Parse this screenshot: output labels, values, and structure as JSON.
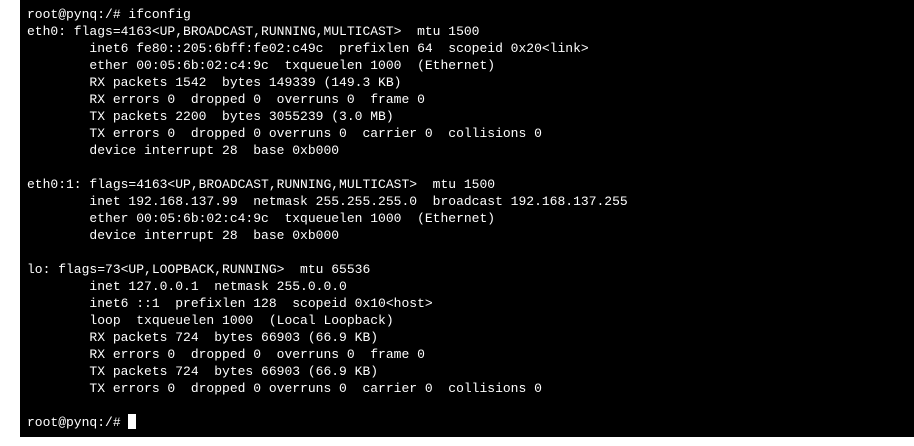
{
  "terminal": {
    "lines": [
      "root@pynq:/# ifconfig",
      "eth0: flags=4163<UP,BROADCAST,RUNNING,MULTICAST>  mtu 1500",
      "        inet6 fe80::205:6bff:fe02:c49c  prefixlen 64  scopeid 0x20<link>",
      "        ether 00:05:6b:02:c4:9c  txqueuelen 1000  (Ethernet)",
      "        RX packets 1542  bytes 149339 (149.3 KB)",
      "        RX errors 0  dropped 0  overruns 0  frame 0",
      "        TX packets 2200  bytes 3055239 (3.0 MB)",
      "        TX errors 0  dropped 0 overruns 0  carrier 0  collisions 0",
      "        device interrupt 28  base 0xb000",
      "",
      "eth0:1: flags=4163<UP,BROADCAST,RUNNING,MULTICAST>  mtu 1500",
      "        inet 192.168.137.99  netmask 255.255.255.0  broadcast 192.168.137.255",
      "        ether 00:05:6b:02:c4:9c  txqueuelen 1000  (Ethernet)",
      "        device interrupt 28  base 0xb000",
      "",
      "lo: flags=73<UP,LOOPBACK,RUNNING>  mtu 65536",
      "        inet 127.0.0.1  netmask 255.0.0.0",
      "        inet6 ::1  prefixlen 128  scopeid 0x10<host>",
      "        loop  txqueuelen 1000  (Local Loopback)",
      "        RX packets 724  bytes 66903 (66.9 KB)",
      "        RX errors 0  dropped 0  overruns 0  frame 0",
      "        TX packets 724  bytes 66903 (66.9 KB)",
      "        TX errors 0  dropped 0 overruns 0  carrier 0  collisions 0",
      "",
      "root@pynq:/# "
    ]
  }
}
